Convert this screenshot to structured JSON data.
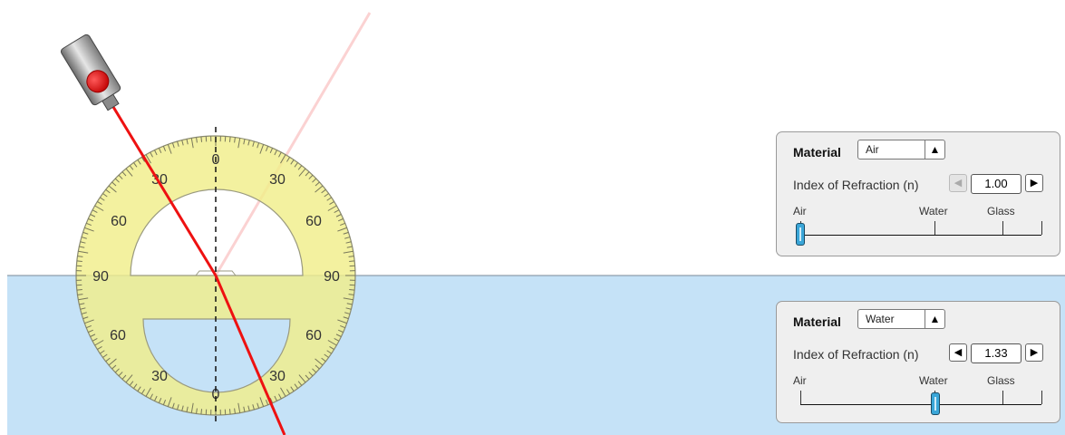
{
  "colors": {
    "water": "#c5e2f7",
    "protractor": "#f0ee8a",
    "laser_beam": "#ee1111",
    "reflected_beam": "#fbd2d2"
  },
  "protractor": {
    "labels": {
      "top_center": "0",
      "top_left_30": "30",
      "top_right_30": "30",
      "top_left_60": "60",
      "top_right_60": "60",
      "left_90": "90",
      "right_90": "90",
      "bottom_left_60": "60",
      "bottom_right_60": "60",
      "bottom_left_30": "30",
      "bottom_right_30": "30",
      "bottom_center": "0"
    }
  },
  "top_medium": {
    "material_label": "Material",
    "material_value": "Air",
    "select_arrow": "▲",
    "ior_label": "Index of Refraction (n)",
    "ior_value": "1.00",
    "decrement": "◀",
    "increment": "▶",
    "slider_labels": {
      "air": "Air",
      "water": "Water",
      "glass": "Glass"
    },
    "slider_value": 1.0
  },
  "bottom_medium": {
    "material_label": "Material",
    "material_value": "Water",
    "select_arrow": "▲",
    "ior_label": "Index of Refraction (n)",
    "ior_value": "1.33",
    "decrement": "◀",
    "increment": "▶",
    "slider_labels": {
      "air": "Air",
      "water": "Water",
      "glass": "Glass"
    },
    "slider_value": 1.33
  }
}
